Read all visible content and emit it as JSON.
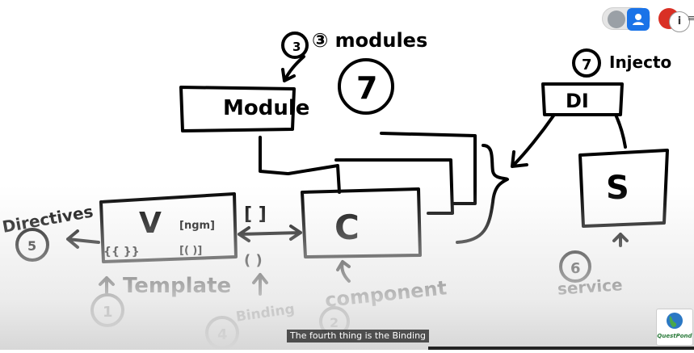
{
  "whiteboard": {
    "label_modules": "③ modules",
    "label_seven_center": "7",
    "label_module_box": "Module",
    "label_injector_num": "7",
    "label_injector": "Injecto",
    "label_di": "DI",
    "label_s": "S",
    "label_c": "C",
    "label_v": "V",
    "label_template_bindings_left": "{{ }}",
    "label_template_bindings_right_top": "[ngm]",
    "label_template_bindings_right_bottom": "[(  )]",
    "label_square_brackets": "[ ]",
    "label_round_brackets": "( )",
    "label_directives": "Directives",
    "label_directives_num": "5",
    "label_template": "Template",
    "label_template_num": "1",
    "label_binding": "Binding",
    "label_binding_num": "4",
    "label_component": "component",
    "label_component_num": "2",
    "label_service": "service",
    "label_service_num": "6"
  },
  "player": {
    "caption": "The fourth thing is the Binding",
    "logo_text": "QuestPond",
    "info_icon": "i",
    "menu_icon": "≡"
  },
  "colors": {
    "ink": "#000000",
    "toggle_blue": "#1a73e8",
    "record_red": "#d93025"
  }
}
